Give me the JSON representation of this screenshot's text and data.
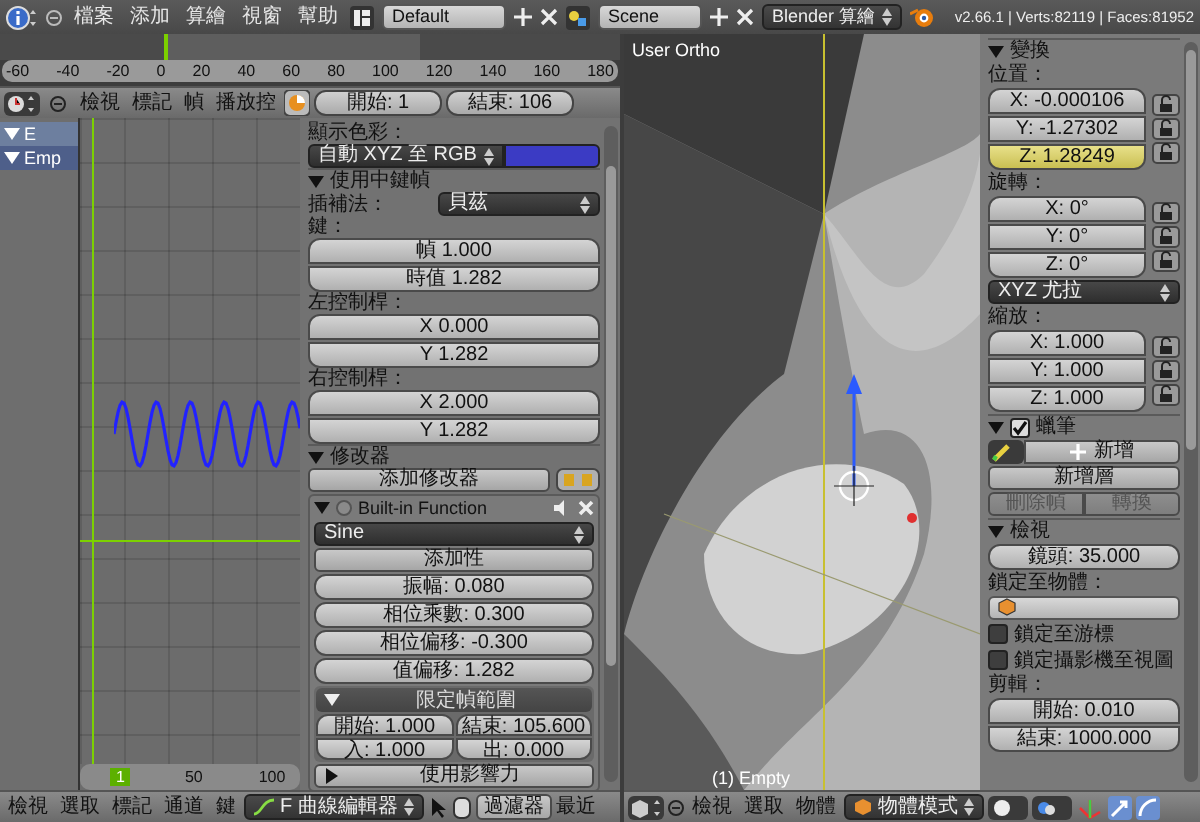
{
  "top_bar": {
    "menus": [
      "檔案",
      "添加",
      "算繪",
      "視窗",
      "幫助"
    ],
    "layout": "Default",
    "scene": "Scene",
    "engine": "Blender 算繪",
    "stats": "v2.66.1 | Verts:82119 | Faces:81952"
  },
  "timeline": {
    "ticks": [
      "-60",
      "-40",
      "-20",
      "0",
      "20",
      "40",
      "60",
      "80",
      "100",
      "120",
      "140",
      "160",
      "180"
    ],
    "menus": [
      "檢視",
      "標記",
      "幀",
      "播放控"
    ],
    "start": "開始: 1",
    "end": "結束: 106"
  },
  "channels": [
    "E",
    "Emp"
  ],
  "graph": {
    "frame_labels": [
      "1",
      "50",
      "100"
    ]
  },
  "properties": [
    {
      "kind": "label",
      "text": "顯示色彩："
    },
    {
      "kind": "color_select",
      "value": "自動 XYZ 至 RGB"
    },
    {
      "kind": "header",
      "text": "使用中鍵幀",
      "expanded": true
    },
    {
      "kind": "select_row",
      "label": "插補法：",
      "value": "貝茲"
    },
    {
      "kind": "label",
      "text": "鍵："
    },
    {
      "kind": "fields",
      "items": [
        {
          "text": "幀 1.000"
        },
        {
          "text": "時值 1.282"
        }
      ]
    },
    {
      "kind": "label",
      "text": "左控制桿："
    },
    {
      "kind": "fields",
      "items": [
        {
          "text": "X 0.000"
        },
        {
          "text": "Y 1.282"
        }
      ]
    },
    {
      "kind": "label",
      "text": "右控制桿："
    },
    {
      "kind": "fields",
      "items": [
        {
          "text": "X 2.000"
        },
        {
          "text": "Y 1.282"
        }
      ]
    },
    {
      "kind": "header",
      "text": "修改器",
      "expanded": true
    },
    {
      "kind": "button",
      "text": "添加修改器",
      "copy_paste": true
    },
    {
      "kind": "modifier",
      "name": "Built-in Function",
      "expanded": true,
      "function": "Sine",
      "additive": "添加性",
      "fields": [
        {
          "text": "振幅: 0.080"
        },
        {
          "text": "相位乘數: 0.300"
        },
        {
          "text": "相位偏移: -0.300"
        },
        {
          "text": "值偏移: 1.282"
        }
      ],
      "range": {
        "title": "限定幀範圍",
        "expanded": true,
        "rows": [
          [
            "開始: 1.000",
            "結束: 105.600"
          ],
          [
            "入: 1.000",
            "出: 0.000"
          ]
        ]
      },
      "influence": {
        "title": "使用影響力",
        "expanded": false
      }
    }
  ],
  "viewport": {
    "view_name": "User Ortho",
    "object_label": "(1) Empty"
  },
  "n_panel": [
    {
      "kind": "header",
      "text": "變換",
      "expanded": true
    },
    {
      "kind": "label",
      "text": "位置："
    },
    {
      "kind": "fields",
      "lock": true,
      "items": [
        {
          "text": "X: -0.000106",
          "keyed": false
        },
        {
          "text": "Y: -1.27302",
          "keyed": false
        },
        {
          "text": "Z: 1.28249",
          "keyed": true
        }
      ]
    },
    {
      "kind": "label",
      "text": "旋轉："
    },
    {
      "kind": "fields",
      "lock": true,
      "items": [
        {
          "text": "X: 0°",
          "keyed": false
        },
        {
          "text": "Y: 0°",
          "keyed": false
        },
        {
          "text": "Z: 0°",
          "keyed": false
        }
      ]
    },
    {
      "kind": "select",
      "value": "XYZ 尤拉"
    },
    {
      "kind": "label",
      "text": "縮放："
    },
    {
      "kind": "fields",
      "lock": true,
      "items": [
        {
          "text": "X: 1.000",
          "keyed": false
        },
        {
          "text": "Y: 1.000",
          "keyed": false
        },
        {
          "text": "Z: 1.000",
          "keyed": false
        }
      ]
    },
    {
      "kind": "check_header",
      "text": "蠟筆",
      "expanded": true,
      "checked": true
    },
    {
      "kind": "pencil_row",
      "text": "新增"
    },
    {
      "kind": "button",
      "text": "新增層"
    },
    {
      "kind": "split",
      "items": [
        "刪除幀",
        "轉換"
      ],
      "disabled": true
    },
    {
      "kind": "header",
      "text": "檢視",
      "expanded": true
    },
    {
      "kind": "fields",
      "items": [
        {
          "text": "鏡頭: 35.000"
        }
      ]
    },
    {
      "kind": "label",
      "text": "鎖定至物體："
    },
    {
      "kind": "object_field"
    },
    {
      "kind": "checkbox",
      "text": "鎖定至游標",
      "checked": false
    },
    {
      "kind": "checkbox",
      "text": "鎖定攝影機至視圖",
      "checked": false
    },
    {
      "kind": "label",
      "text": "剪輯："
    },
    {
      "kind": "fields",
      "items": [
        {
          "text": "開始: 0.010"
        },
        {
          "text": "結束: 1000.000"
        }
      ]
    }
  ],
  "graph_header": {
    "menus": [
      "檢視",
      "選取",
      "標記",
      "通道",
      "鍵"
    ],
    "editor": "F 曲線編輯器",
    "filter": "過濾器",
    "cut_label": "最近"
  },
  "viewport_header": {
    "menus": [
      "檢視",
      "選取",
      "物體"
    ],
    "mode": "物體模式"
  }
}
